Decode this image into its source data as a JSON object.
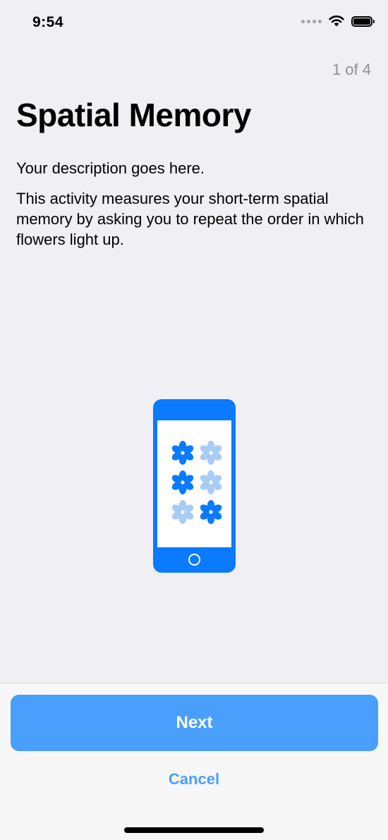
{
  "status_bar": {
    "time": "9:54",
    "icons": [
      "signal-dots-icon",
      "wifi-icon",
      "battery-icon"
    ]
  },
  "header": {
    "step_counter": "1 of 4"
  },
  "main": {
    "title": "Spatial Memory",
    "description": "Your description goes here.",
    "detail": "This activity measures your short-term spatial memory by asking you to repeat the order in which flowers light up."
  },
  "illustration": {
    "icon": "phone-flowers-icon",
    "colors": {
      "phone": "#0a7aff",
      "flower_active": "#0a7aff",
      "flower_inactive": "#a8cdf5"
    },
    "flowers": [
      {
        "active": true
      },
      {
        "active": false
      },
      {
        "active": true
      },
      {
        "active": false
      },
      {
        "active": false
      },
      {
        "active": true
      }
    ]
  },
  "footer": {
    "next_label": "Next",
    "cancel_label": "Cancel"
  },
  "colors": {
    "background": "#efeff4",
    "accent": "#4a9ffd",
    "secondary_text": "#8e8e93"
  }
}
